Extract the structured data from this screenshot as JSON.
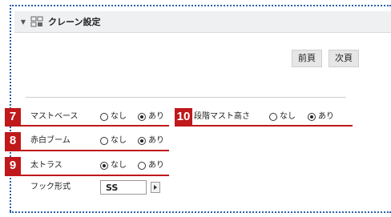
{
  "panel": {
    "title": "クレーン設定",
    "icons": {
      "caret": "caret-down-icon",
      "header": "crane-settings-icon"
    }
  },
  "buttons": {
    "prev": "前頁",
    "next": "次頁"
  },
  "options": {
    "none": "なし",
    "present": "あり"
  },
  "rows": [
    {
      "badge": "7",
      "label": "マストベース",
      "selected": "present"
    },
    {
      "badge": "8",
      "label": "赤白ブーム",
      "selected": "present"
    },
    {
      "badge": "9",
      "label": "太トラス",
      "selected": "none"
    },
    {
      "badge": "10",
      "label": "段階マスト高さ",
      "selected": "present"
    }
  ],
  "hook": {
    "label": "フック形式",
    "value": "SS"
  },
  "colors": {
    "badge": "#c0181b",
    "dotted_border": "#2a5fb0",
    "header_bg": "#eef0f2"
  }
}
